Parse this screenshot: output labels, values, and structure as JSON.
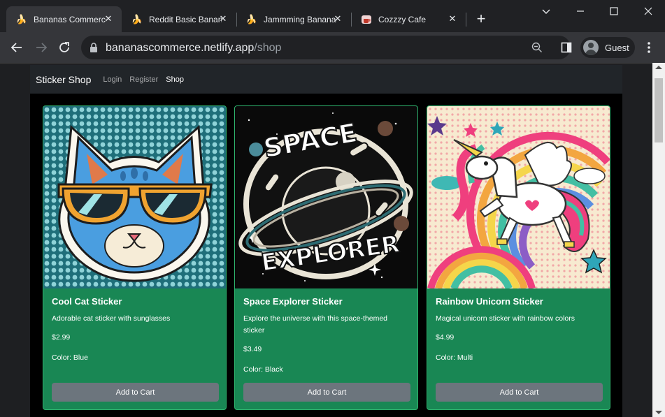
{
  "browser": {
    "tabs": [
      {
        "title": "Bananas Commerce",
        "favicon": "banana-icon"
      },
      {
        "title": "Reddit Basic Bananas",
        "favicon": "banana-icon"
      },
      {
        "title": "Jammming Bananas",
        "favicon": "banana-icon"
      },
      {
        "title": "Cozzzy Cafe",
        "favicon": "cafe-icon"
      }
    ],
    "url": {
      "host": "bananascommerce.netlify.app",
      "path": "/shop"
    },
    "profile_label": "Guest"
  },
  "site": {
    "brand": "Sticker Shop",
    "nav": [
      "Login",
      "Register",
      "Shop"
    ]
  },
  "products": [
    {
      "name": "Cool Cat Sticker",
      "description": "Adorable cat sticker with sunglasses",
      "price": "$2.99",
      "color": "Color: Blue",
      "button": "Add to Cart"
    },
    {
      "name": "Space Explorer Sticker",
      "description": "Explore the universe with this space-themed sticker",
      "price": "$3.49",
      "color": "Color: Black",
      "button": "Add to Cart",
      "image_text": [
        "SPACE",
        "EXPLORER"
      ]
    },
    {
      "name": "Rainbow Unicorn Sticker",
      "description": "Magical unicorn sticker with rainbow colors",
      "price": "$4.99",
      "color": "Color: Multi",
      "button": "Add to Cart"
    }
  ],
  "colors": {
    "card": "#198754",
    "button": "#6c757d",
    "navbar": "#212529"
  }
}
